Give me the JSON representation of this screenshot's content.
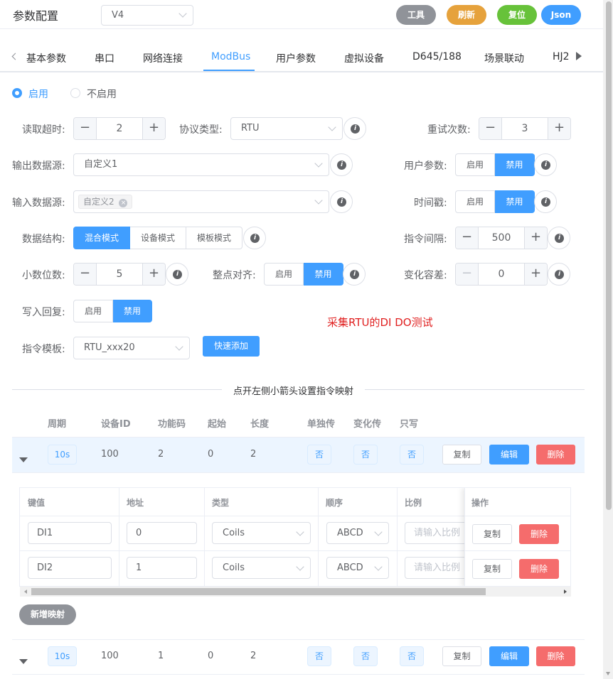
{
  "header": {
    "title": "参数配置",
    "version_value": "V4",
    "buttons": {
      "tools": "工具",
      "refresh": "刷新",
      "reset": "复位",
      "json": "Json"
    }
  },
  "tabs": [
    "基本参数",
    "串口",
    "网络连接",
    "ModBus",
    "用户参数",
    "虚拟设备",
    "D645/188",
    "场景联动",
    "HJ2"
  ],
  "active_tab": "ModBus",
  "enable": {
    "on_label": "启用",
    "off_label": "不启用",
    "selected": "启用"
  },
  "form": {
    "read_timeout": {
      "label": "读取超时:",
      "value": "2"
    },
    "protocol": {
      "label": "协议类型:",
      "value": "RTU"
    },
    "retries": {
      "label": "重试次数:",
      "value": "3"
    },
    "output_source": {
      "label": "输出数据源:",
      "value": "自定义1"
    },
    "user_params": {
      "label": "用户参数:",
      "options": [
        "启用",
        "禁用"
      ],
      "selected": "禁用"
    },
    "input_source": {
      "label": "输入数据源:",
      "tag": "自定义2"
    },
    "timestamp": {
      "label": "时间戳:",
      "options": [
        "启用",
        "禁用"
      ],
      "selected": "禁用"
    },
    "data_structure": {
      "label": "数据结构:",
      "options": [
        "混合模式",
        "设备模式",
        "模板模式"
      ],
      "selected": "混合模式"
    },
    "cmd_interval": {
      "label": "指令间隔:",
      "value": "500"
    },
    "decimals": {
      "label": "小数位数:",
      "value": "5"
    },
    "align": {
      "label": "整点对齐:",
      "options": [
        "启用",
        "禁用"
      ],
      "selected": "禁用"
    },
    "tolerance": {
      "label": "变化容差:",
      "value": "0"
    },
    "write_reply": {
      "label": "写入回复:",
      "options": [
        "启用",
        "禁用"
      ],
      "selected": "禁用"
    },
    "template": {
      "label": "指令模板:",
      "value": "RTU_xxx20"
    },
    "quick_add": "快速添加",
    "note": "采集RTU的DI DO测试"
  },
  "divider_text": "点开左侧小箭头设置指令映射",
  "commands": {
    "columns": [
      "周期",
      "设备ID",
      "功能码",
      "起始",
      "长度",
      "单独传",
      "变化传",
      "只写"
    ],
    "rows": [
      {
        "period": "10s",
        "device_id": "100",
        "func": "2",
        "start": "0",
        "length": "2",
        "single": "否",
        "change": "否",
        "write_only": "否",
        "copy": "复制",
        "edit": "编辑",
        "delete": "删除"
      },
      {
        "period": "10s",
        "device_id": "100",
        "func": "1",
        "start": "0",
        "length": "2",
        "single": "否",
        "change": "否",
        "write_only": "否",
        "copy": "复制",
        "edit": "编辑",
        "delete": "删除"
      }
    ]
  },
  "mapping": {
    "columns": [
      "键值",
      "地址",
      "类型",
      "顺序",
      "比例",
      "操作"
    ],
    "rows": [
      {
        "key": "DI1",
        "address": "0",
        "type": "Coils",
        "order": "ABCD",
        "ratio_placeholder": "请输入比例",
        "copy": "复制",
        "delete": "删除"
      },
      {
        "key": "DI2",
        "address": "1",
        "type": "Coils",
        "order": "ABCD",
        "ratio_placeholder": "请输入比例",
        "copy": "复制",
        "delete": "删除"
      }
    ],
    "add_button": "新增映射"
  },
  "colors": {
    "primary": "#409eff",
    "danger": "#f56c6c",
    "warning": "#e6a23c",
    "success": "#67c23a",
    "info": "#909399",
    "note_red": "#e02020"
  }
}
